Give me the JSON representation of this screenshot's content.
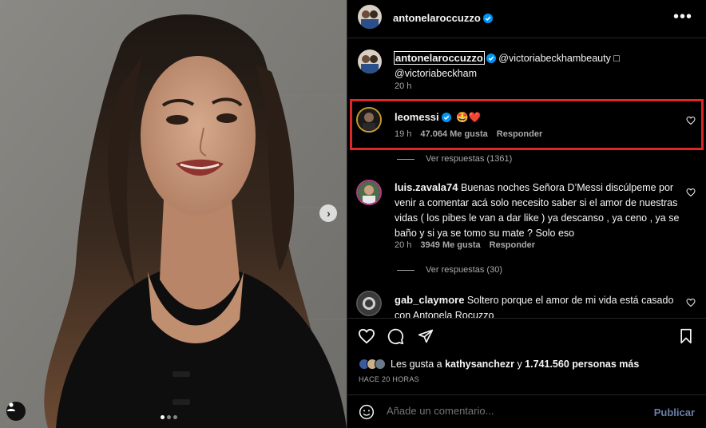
{
  "post": {
    "author": "antonelaroccuzzo",
    "more_icon": "more-horizontal-icon"
  },
  "caption": {
    "author": "antonelaroccuzzo",
    "text": "@victoriabeckhambeauty □",
    "text2": "@victoriabeckham",
    "time": "20 h"
  },
  "comments": [
    {
      "user": "leomessi",
      "text": "🤩❤️",
      "time": "19 h",
      "likes": "47.064 Me gusta",
      "reply": "Responder",
      "replies": "Ver respuestas (1361)"
    },
    {
      "user": "luis.zavala74",
      "text": "Buenas noches Señora D’Messi discúlpeme por venir a comentar acá solo necesito saber si el amor de nuestras vidas ( los pibes le van a dar like ) ya descanso , ya ceno , ya se baño y si ya se tomo su mate ? Solo eso",
      "time": "20 h",
      "likes": "3949 Me gusta",
      "reply": "Responder",
      "replies": "Ver respuestas (30)"
    },
    {
      "user": "gab_claymore",
      "text": "Soltero porque el amor de mi vida está casado con Antonela Rocuzzo"
    }
  ],
  "likes": {
    "prefix": "Les gusta a ",
    "user": "kathysanchezr",
    "middle": " y ",
    "count": "1.741.560 personas más"
  },
  "timeago": "HACE 20 HORAS",
  "composer": {
    "placeholder": "Añade un comentario...",
    "publish": "Publicar"
  },
  "colors": {
    "background": "#000000",
    "verified": "#0095f6",
    "highlight": "#e0262b",
    "secondary_text": "#a8a8a8"
  },
  "carousel": {
    "slides": 3,
    "active": 1
  }
}
